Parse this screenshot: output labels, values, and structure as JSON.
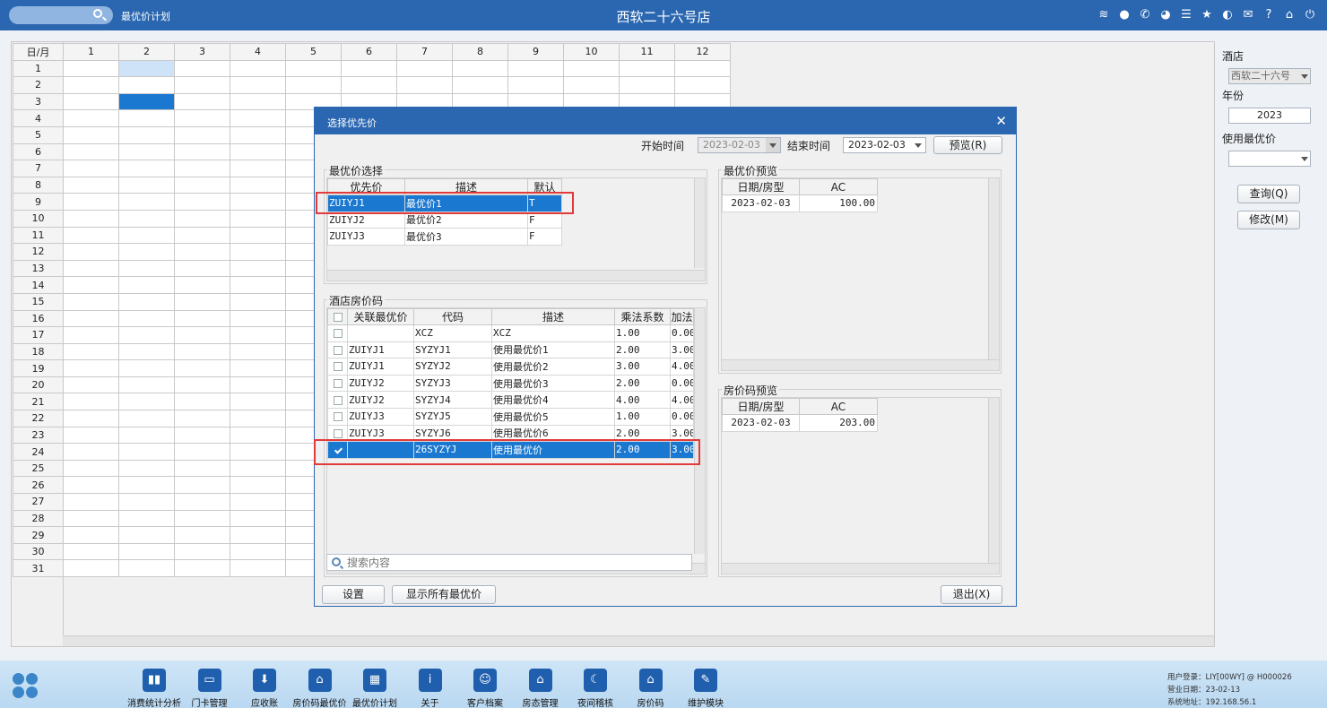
{
  "topbar": {
    "module_title": "最优价计划",
    "app_title": "西软二十六号店",
    "icons": [
      "wifi-icon",
      "chat-icon",
      "phone-icon",
      "palette-icon",
      "menu-icon",
      "star-icon",
      "contrast-icon",
      "mail-icon",
      "help-icon",
      "home-icon",
      "power-icon"
    ]
  },
  "calendar": {
    "corner": "日/月",
    "months": [
      "1",
      "2",
      "3",
      "4",
      "5",
      "6",
      "7",
      "8",
      "9",
      "10",
      "11",
      "12"
    ],
    "days": [
      "1",
      "2",
      "3",
      "4",
      "5",
      "6",
      "7",
      "8",
      "9",
      "10",
      "11",
      "12",
      "13",
      "14",
      "15",
      "16",
      "17",
      "18",
      "19",
      "20",
      "21",
      "22",
      "23",
      "24",
      "25",
      "26",
      "27",
      "28",
      "29",
      "30",
      "31"
    ],
    "selected_light": {
      "day": 1,
      "month": 2
    },
    "selected_dark": {
      "day": 3,
      "month": 2
    }
  },
  "right_panel": {
    "hotel_label": "酒店",
    "hotel_value": "西软二十六号",
    "year_label": "年份",
    "year_value": "2023",
    "best_price_label": "使用最优价",
    "best_price_value": "",
    "query_button": "查询(Q)",
    "modify_button": "修改(M)"
  },
  "dialog": {
    "title": "选择优先价",
    "start_label": "开始时间",
    "start_value": "2023-02-03",
    "end_label": "结束时间",
    "end_value": "2023-02-03",
    "preview_button": "预览(R)",
    "best_price_group": {
      "title": "最优价选择",
      "columns": [
        "优先价",
        "描述",
        "默认"
      ],
      "rows": [
        {
          "code": "ZUIYJ1",
          "desc": "最优价1",
          "default": "T"
        },
        {
          "code": "ZUIYJ2",
          "desc": "最优价2",
          "default": "F"
        },
        {
          "code": "ZUIYJ3",
          "desc": "最优价3",
          "default": "F"
        }
      ],
      "selected_index": 0
    },
    "hotel_rate_group": {
      "title": "酒店房价码",
      "columns": [
        "关联最优价",
        "代码",
        "描述",
        "乘法系数",
        "加法"
      ],
      "rows": [
        {
          "checked": false,
          "link": "",
          "code": "XCZ",
          "desc": "XCZ",
          "mult": "1.00",
          "add": "0.00"
        },
        {
          "checked": false,
          "link": "ZUIYJ1",
          "code": "SYZYJ1",
          "desc": "使用最优价1",
          "mult": "2.00",
          "add": "3.00"
        },
        {
          "checked": false,
          "link": "ZUIYJ1",
          "code": "SYZYJ2",
          "desc": "使用最优价2",
          "mult": "3.00",
          "add": "4.00"
        },
        {
          "checked": false,
          "link": "ZUIYJ2",
          "code": "SYZYJ3",
          "desc": "使用最优价3",
          "mult": "2.00",
          "add": "0.00"
        },
        {
          "checked": false,
          "link": "ZUIYJ2",
          "code": "SYZYJ4",
          "desc": "使用最优价4",
          "mult": "4.00",
          "add": "4.00"
        },
        {
          "checked": false,
          "link": "ZUIYJ3",
          "code": "SYZYJ5",
          "desc": "使用最优价5",
          "mult": "1.00",
          "add": "0.00"
        },
        {
          "checked": false,
          "link": "ZUIYJ3",
          "code": "SYZYJ6",
          "desc": "使用最优价6",
          "mult": "2.00",
          "add": "3.00"
        },
        {
          "checked": true,
          "link": "",
          "code": "26SYZYJ",
          "desc": "使用最优价",
          "mult": "2.00",
          "add": "3.00"
        }
      ],
      "selected_index": 7,
      "search_placeholder": "搜索内容"
    },
    "best_price_preview": {
      "title": "最优价预览",
      "columns": [
        "日期/房型",
        "AC"
      ],
      "rows": [
        {
          "date": "2023-02-03",
          "ac": "100.00"
        }
      ]
    },
    "rate_code_preview": {
      "title": "房价码预览",
      "columns": [
        "日期/房型",
        "AC"
      ],
      "rows": [
        {
          "date": "2023-02-03",
          "ac": "203.00"
        }
      ]
    },
    "settings_button": "设置",
    "show_all_button": "显示所有最优价",
    "exit_button": "退出(X)"
  },
  "taskbar": {
    "items": [
      {
        "label": "消费统计分析",
        "icon": "bar-chart-icon",
        "glyph": "▮▮"
      },
      {
        "label": "门卡管理",
        "icon": "card-icon",
        "glyph": "▭"
      },
      {
        "label": "应收账",
        "icon": "download-icon",
        "glyph": "⬇"
      },
      {
        "label": "房价码最优价",
        "icon": "house-price-icon",
        "glyph": "⌂"
      },
      {
        "label": "最优价计划",
        "icon": "calendar-icon",
        "glyph": "▦"
      },
      {
        "label": "关于",
        "icon": "info-icon",
        "glyph": "i"
      },
      {
        "label": "客户档案",
        "icon": "profile-icon",
        "glyph": "☺"
      },
      {
        "label": "房态管理",
        "icon": "home-icon",
        "glyph": "⌂"
      },
      {
        "label": "夜间稽核",
        "icon": "moon-icon",
        "glyph": "☾"
      },
      {
        "label": "房价码",
        "icon": "house-icon",
        "glyph": "⌂"
      },
      {
        "label": "维护模块",
        "icon": "wrench-icon",
        "glyph": "✎"
      }
    ],
    "user_login": "用户登录：LIY[00WY] @ H000026",
    "business_date": "营业日期：23-02-13",
    "system_address": "系统地址：192.168.56.1"
  }
}
